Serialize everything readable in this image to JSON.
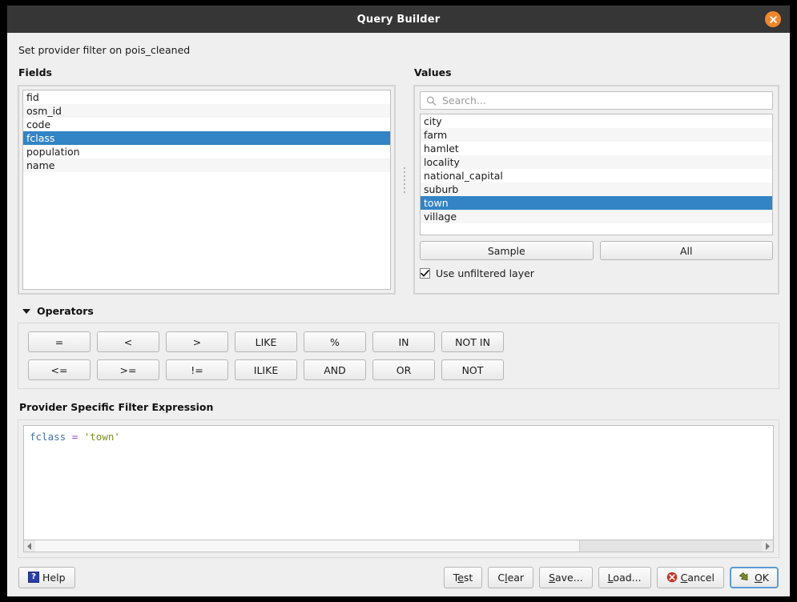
{
  "window": {
    "title": "Query Builder",
    "close_icon": "close-circle-icon",
    "subtitle": "Set provider filter on pois_cleaned"
  },
  "fields": {
    "label": "Fields",
    "items": [
      {
        "name": "fid",
        "selected": false
      },
      {
        "name": "osm_id",
        "selected": false
      },
      {
        "name": "code",
        "selected": false
      },
      {
        "name": "fclass",
        "selected": true
      },
      {
        "name": "population",
        "selected": false
      },
      {
        "name": "name",
        "selected": false
      }
    ]
  },
  "values": {
    "label": "Values",
    "search": {
      "placeholder": "Search...",
      "value": "",
      "icon": "search-icon"
    },
    "items": [
      {
        "name": "city",
        "selected": false
      },
      {
        "name": "farm",
        "selected": false
      },
      {
        "name": "hamlet",
        "selected": false
      },
      {
        "name": "locality",
        "selected": false
      },
      {
        "name": "national_capital",
        "selected": false
      },
      {
        "name": "suburb",
        "selected": false
      },
      {
        "name": "town",
        "selected": true
      },
      {
        "name": "village",
        "selected": false
      }
    ],
    "sample_label": "Sample",
    "all_label": "All",
    "unfiltered": {
      "label": "Use unfiltered layer",
      "checked": true,
      "check_glyph": "✔"
    }
  },
  "operators": {
    "label": "Operators",
    "expanded": true,
    "collapse_icon": "triangle-down-icon",
    "row1": [
      "=",
      "<",
      ">",
      "LIKE",
      "%",
      "IN",
      "NOT IN"
    ],
    "row2": [
      "<=",
      ">=",
      "!=",
      "ILIKE",
      "AND",
      "OR",
      "NOT"
    ]
  },
  "expression": {
    "label": "Provider Specific Filter Expression",
    "text": "fclass = 'town'",
    "tokens": {
      "field": "fclass",
      "operator": "=",
      "string": "'town'"
    },
    "scrollbar": {
      "left_arrow": "◀",
      "right_arrow": "▶",
      "thumb_percent": 75
    }
  },
  "footer": {
    "help": {
      "label": "Help",
      "icon": "help-icon",
      "mnemonic": "H"
    },
    "test": {
      "pre": "T",
      "mn": "e",
      "post": "st"
    },
    "clear": {
      "pre": "C",
      "mn": "l",
      "post": "ear"
    },
    "save": {
      "pre": "",
      "mn": "S",
      "post": "ave..."
    },
    "load": {
      "pre": "",
      "mn": "L",
      "post": "oad..."
    },
    "cancel": {
      "pre": "",
      "mn": "C",
      "post": "ancel",
      "icon": "cancel-icon"
    },
    "ok": {
      "pre": "",
      "mn": "O",
      "post": "K",
      "icon": "ok-check-icon",
      "is_default": true
    }
  },
  "colors": {
    "titlebar": "#363636",
    "close_button": "#f0862c",
    "selection": "#3284c4",
    "dialog_bg": "#efefef",
    "token_field": "#4176a8",
    "token_operator": "#8e44c0",
    "token_string": "#7f8f20",
    "focus_ring": "#5b9bd5"
  }
}
